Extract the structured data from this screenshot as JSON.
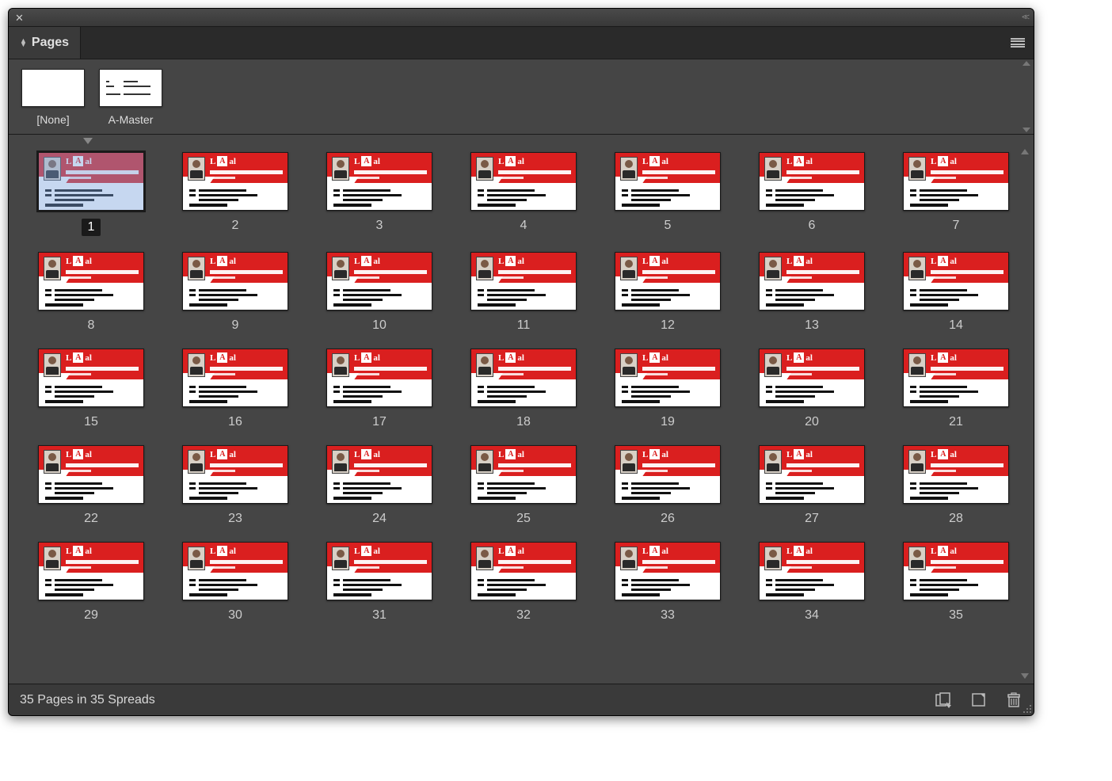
{
  "panel": {
    "title": "Pages"
  },
  "masters": [
    {
      "label": "[None]",
      "has_content": false
    },
    {
      "label": "A-Master",
      "has_content": true
    }
  ],
  "selected_page": 1,
  "page_count": 35,
  "spread_count": 35,
  "footer": {
    "status": "35 Pages in 35 Spreads"
  },
  "logo": {
    "left": "L",
    "mid": "A",
    "right": "al"
  },
  "pages": [
    {
      "n": 1
    },
    {
      "n": 2
    },
    {
      "n": 3
    },
    {
      "n": 4
    },
    {
      "n": 5
    },
    {
      "n": 6
    },
    {
      "n": 7
    },
    {
      "n": 8
    },
    {
      "n": 9
    },
    {
      "n": 10
    },
    {
      "n": 11
    },
    {
      "n": 12
    },
    {
      "n": 13
    },
    {
      "n": 14
    },
    {
      "n": 15
    },
    {
      "n": 16
    },
    {
      "n": 17
    },
    {
      "n": 18
    },
    {
      "n": 19
    },
    {
      "n": 20
    },
    {
      "n": 21
    },
    {
      "n": 22
    },
    {
      "n": 23
    },
    {
      "n": 24
    },
    {
      "n": 25
    },
    {
      "n": 26
    },
    {
      "n": 27
    },
    {
      "n": 28
    },
    {
      "n": 29
    },
    {
      "n": 30
    },
    {
      "n": 31
    },
    {
      "n": 32
    },
    {
      "n": 33
    },
    {
      "n": 34
    },
    {
      "n": 35
    }
  ],
  "icons": {
    "close": "close-icon",
    "collapse": "collapse-icon",
    "panel_menu": "panel-menu-icon",
    "edit_page_size": "edit-page-size-icon",
    "new_page": "new-page-icon",
    "delete_page": "trash-icon"
  }
}
